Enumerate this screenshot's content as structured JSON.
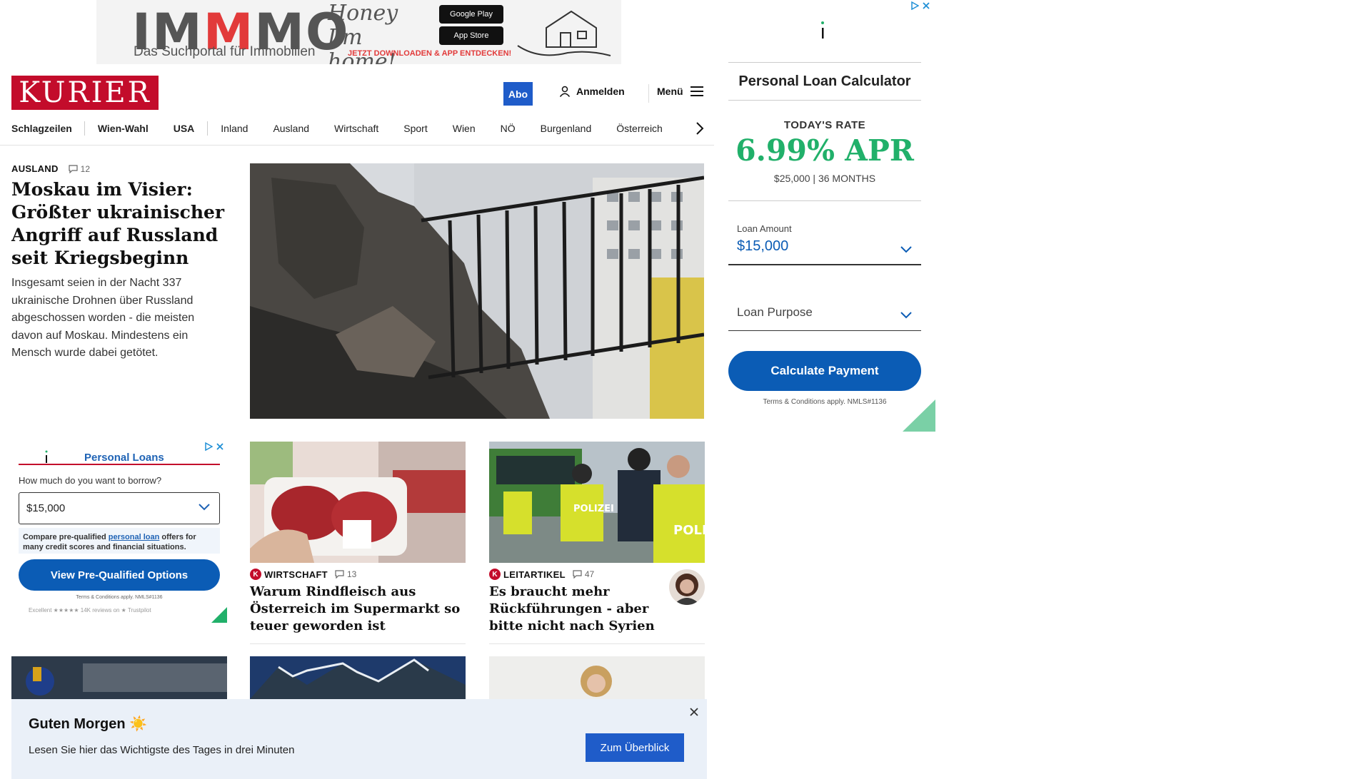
{
  "top_ad": {
    "brand_prefix": "IM",
    "brand_m": "M",
    "brand_suffix": "MO",
    "subtitle": "Das Suchportal für Immobilien",
    "script_text": "Honey I'm home!",
    "google_play": "Google Play",
    "app_store": "App Store",
    "cta": "JETZT DOWNLOADEN & APP ENTDECKEN!"
  },
  "header": {
    "logo": "KURIER",
    "abo_label": "Abo",
    "login_label": "Anmelden",
    "menu_label": "Menü"
  },
  "nav": {
    "items": [
      "Schlagzeilen",
      "Wien-Wahl",
      "USA",
      "Inland",
      "Ausland",
      "Wirtschaft",
      "Sport",
      "Wien",
      "NÖ",
      "Burgenland",
      "Österreich"
    ]
  },
  "lead": {
    "rubrik": "AUSLAND",
    "comments": "12",
    "title": "Moskau im Visier: Größter ukrainischer Angriff auf Russland seit Kriegsbeginn",
    "teaser": "Insgesamt seien in der Nacht 337 ukrainische Drohnen über Russland abgeschossen worden - die meisten davon auf Moskau. Mindestens ein Mensch wurde dabei getötet."
  },
  "cards": [
    {
      "rubrik": "WIRTSCHAFT",
      "comments": "13",
      "title": "Warum Rindfleisch aus Österreich im Supermarkt so teuer geworden ist"
    },
    {
      "rubrik": "LEITARTIKEL",
      "comments": "47",
      "title": "Es braucht mehr Rückführungen - aber bitte nicht nach Syrien"
    }
  ],
  "ad_left": {
    "brand": "Personal Loans",
    "question": "How much do you want to borrow?",
    "amount": "$15,000",
    "note_pre": "Compare pre-qualified ",
    "note_link": "personal loan",
    "note_post": " offers for many credit scores and financial situations.",
    "button": "View Pre-Qualified Options",
    "terms": "Terms & Conditions apply. NMLS#1136",
    "trust": "Excellent ★★★★★ 14K reviews on ★ Trustpilot"
  },
  "ad_right": {
    "title": "Personal Loan Calculator",
    "rate_label": "TODAY'S RATE",
    "rate": "6.99% APR",
    "rate_terms": "$25,000 | 36 MONTHS",
    "amount_label": "Loan Amount",
    "amount": "$15,000",
    "purpose": "Loan Purpose",
    "button": "Calculate Payment",
    "terms": "Terms & Conditions apply. NMLS#1136"
  },
  "toast": {
    "title": "Guten Morgen ☀️",
    "body": "Lesen Sie hier das Wichtigste des Tages in drei Minuten",
    "button": "Zum Überblick"
  },
  "colors": {
    "kurier_red": "#c30c2b",
    "abo_blue": "#1f5cc9",
    "ad_blue": "#0b5cb5",
    "rate_green": "#21b06a"
  }
}
